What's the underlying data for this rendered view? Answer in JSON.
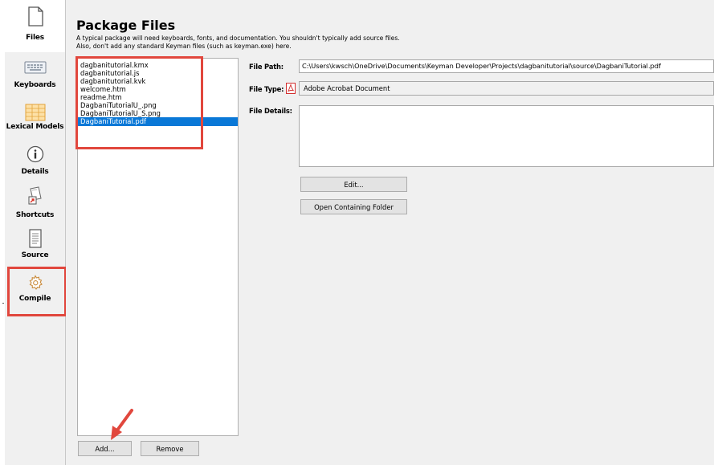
{
  "sidebar": {
    "items": [
      {
        "label": "Files",
        "icon": "file-icon"
      },
      {
        "label": "Keyboards",
        "icon": "keyboard-icon"
      },
      {
        "label": "Lexical Models",
        "icon": "grid-icon"
      },
      {
        "label": "Details",
        "icon": "info-icon"
      },
      {
        "label": "Shortcuts",
        "icon": "shortcut-icon"
      },
      {
        "label": "Source",
        "icon": "document-icon"
      },
      {
        "label": "Compile",
        "icon": "gear-icon"
      }
    ],
    "active": "Files"
  },
  "main": {
    "title": "Package Files",
    "description_line1": "A typical package will need keyboards, fonts, and documentation. You shouldn't typically add source files.",
    "description_line2": "Also, don't add any standard Keyman files (such as keyman.exe) here.",
    "files": [
      "dagbanitutorial.kmx",
      "dagbanitutorial.js",
      "dagbanitutorial.kvk",
      "welcome.htm",
      "readme.htm",
      "DagbaniTutorialU_.png",
      "DagbaniTutorialU_S.png",
      "DagbaniTutorial.pdf"
    ],
    "selected_file": "DagbaniTutorial.pdf",
    "add_label": "Add...",
    "remove_label": "Remove",
    "file_path_label": "File Path:",
    "file_path_value": "C:\\Users\\kwsch\\OneDrive\\Documents\\Keyman Developer\\Projects\\dagbanitutorial\\source\\DagbaniTutorial.pdf",
    "file_type_label": "File Type:",
    "file_type_value": "Adobe Acrobat Document",
    "file_type_icon": "pdf-icon",
    "file_details_label": "File Details:",
    "file_details_value": "",
    "edit_label": "Edit...",
    "open_folder_label": "Open Containing Folder"
  },
  "colors": {
    "highlight": "#e1473d",
    "selection": "#0a78d7",
    "panel_bg": "#f0f0f0"
  }
}
